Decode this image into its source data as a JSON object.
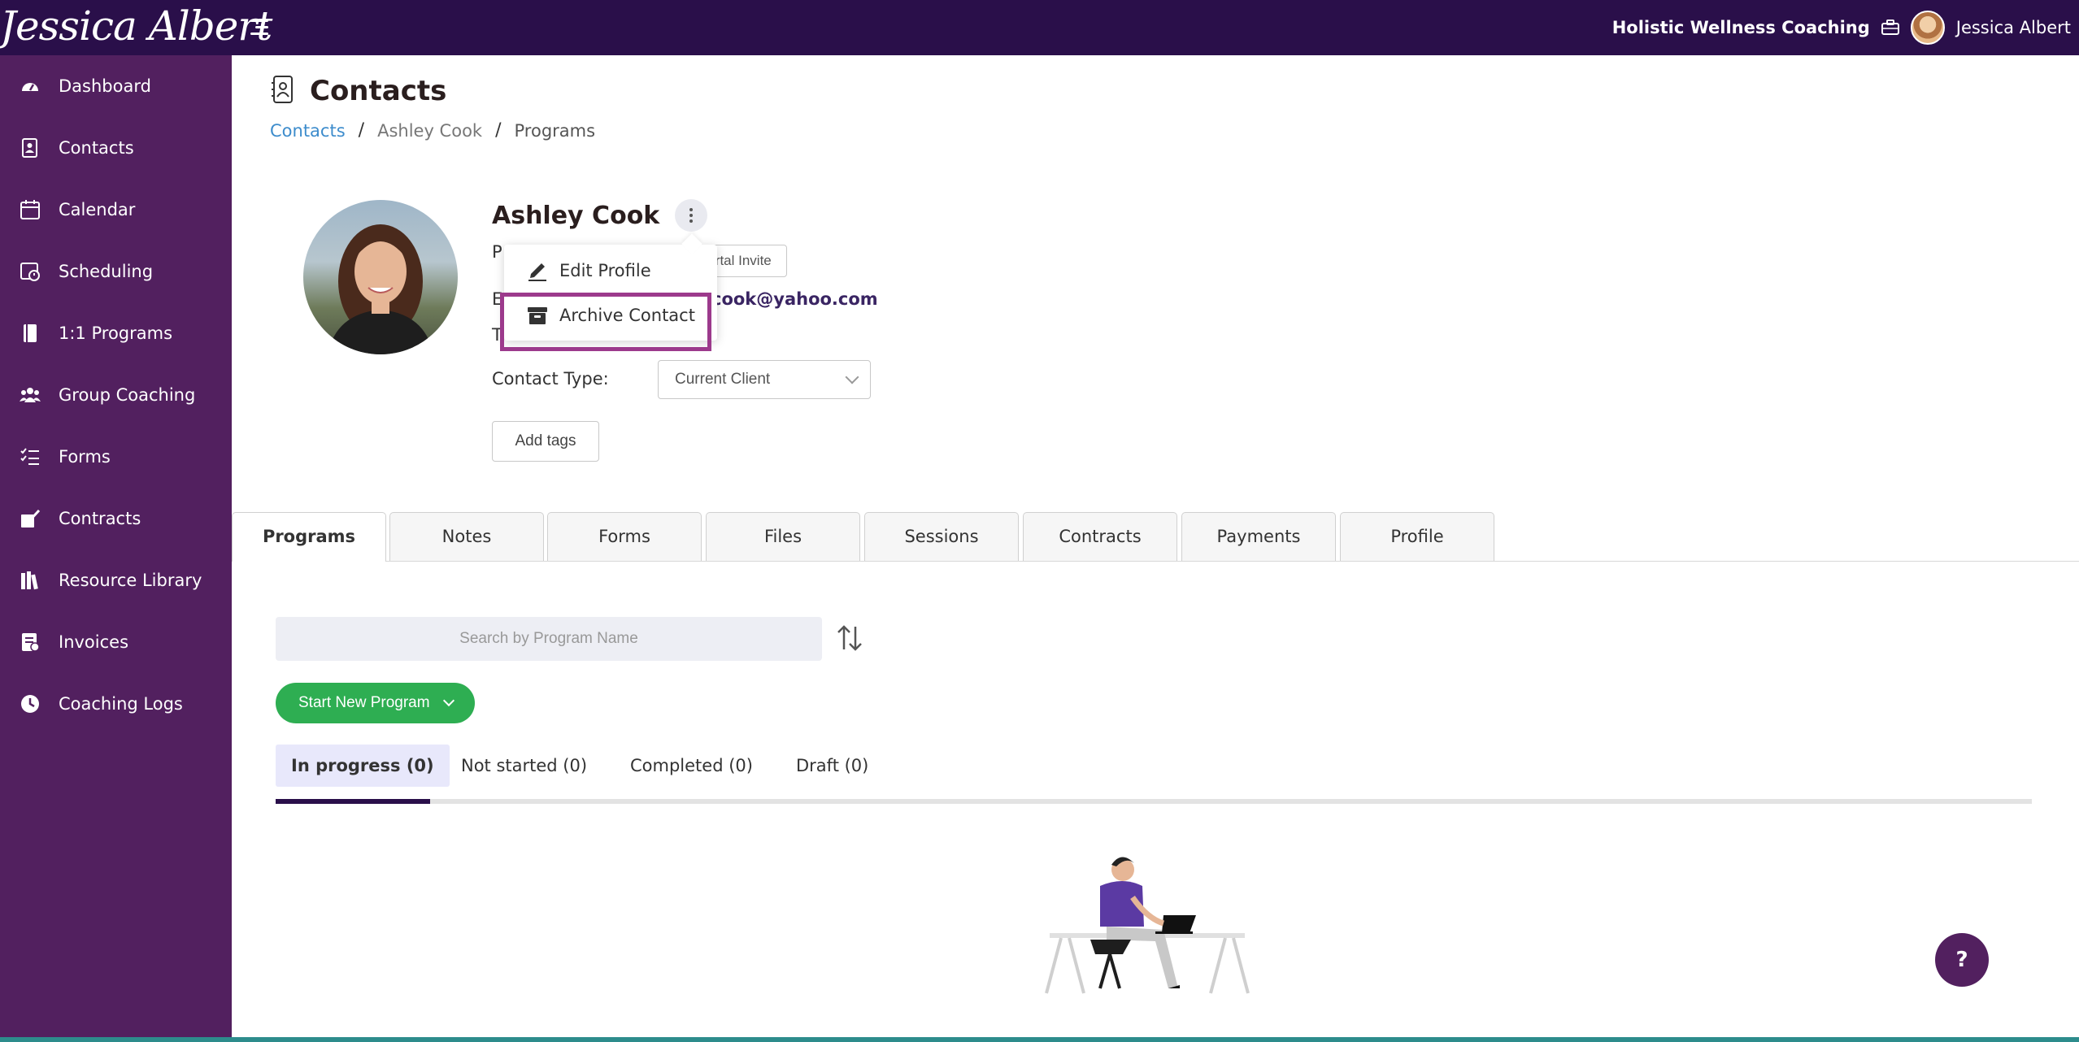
{
  "topbar": {
    "logo_text": "Jessica Albert",
    "business_name": "Holistic Wellness Coaching",
    "user_name": "Jessica Albert"
  },
  "sidebar": {
    "items": [
      {
        "label": "Dashboard",
        "icon": "dashboard-icon"
      },
      {
        "label": "Contacts",
        "icon": "contacts-icon"
      },
      {
        "label": "Calendar",
        "icon": "calendar-icon"
      },
      {
        "label": "Scheduling",
        "icon": "scheduling-icon"
      },
      {
        "label": "1:1 Programs",
        "icon": "programs-icon"
      },
      {
        "label": "Group Coaching",
        "icon": "group-icon"
      },
      {
        "label": "Forms",
        "icon": "forms-icon"
      },
      {
        "label": "Contracts",
        "icon": "contracts-icon"
      },
      {
        "label": "Resource Library",
        "icon": "library-icon"
      },
      {
        "label": "Invoices",
        "icon": "invoices-icon"
      },
      {
        "label": "Coaching Logs",
        "icon": "clock-icon"
      }
    ]
  },
  "page": {
    "title": "Contacts",
    "breadcrumb": [
      "Contacts",
      "Ashley Cook",
      "Programs"
    ],
    "breadcrumb_sep": "/"
  },
  "contact": {
    "name": "Ashley Cook",
    "row_p": "P",
    "row_e": "E",
    "row_t": "T",
    "portal_invite_label": "Portal Invite",
    "email_visible": "cook@yahoo.com",
    "contact_type_label": "Contact Type:",
    "contact_type_value": "Current Client",
    "add_tags_label": "Add tags"
  },
  "dropdown": {
    "items": [
      {
        "label": "Edit Profile",
        "icon": "pencil-icon"
      },
      {
        "label": "Archive Contact",
        "icon": "archive-icon"
      }
    ]
  },
  "tabs": [
    "Programs",
    "Notes",
    "Forms",
    "Files",
    "Sessions",
    "Contracts",
    "Payments",
    "Profile"
  ],
  "programs": {
    "search_placeholder": "Search by Program Name",
    "start_button_label": "Start New Program",
    "subtabs": [
      "In progress (0)",
      "Not started (0)",
      "Completed (0)",
      "Draft (0)"
    ]
  },
  "help_label": "?",
  "colors": {
    "topbar": "#2a0f4a",
    "sidebar": "#52205f",
    "accent_green": "#2eae52",
    "highlight": "#9c3a8c",
    "link_blue": "#3d8ccc"
  }
}
